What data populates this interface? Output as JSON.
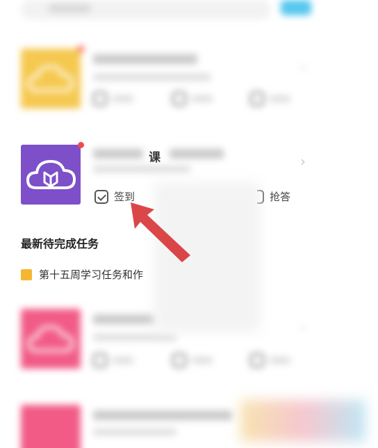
{
  "course2": {
    "title_suffix": "课",
    "actions": {
      "checkin": {
        "label": "签到",
        "icon": "checkin-icon"
      },
      "answer": {
        "label": "抢答",
        "icon": "answer-icon"
      }
    }
  },
  "tasks": {
    "section_title": "最新待完成任务",
    "item_text": "第十五周学习任务和作"
  },
  "colors": {
    "thumb_yellow": "#f5c84f",
    "thumb_purple": "#7d4fc9",
    "thumb_pink": "#f15b86",
    "red_dot": "#f44a4a",
    "arrow_red": "#d8363a",
    "task_square": "#f4b731"
  }
}
